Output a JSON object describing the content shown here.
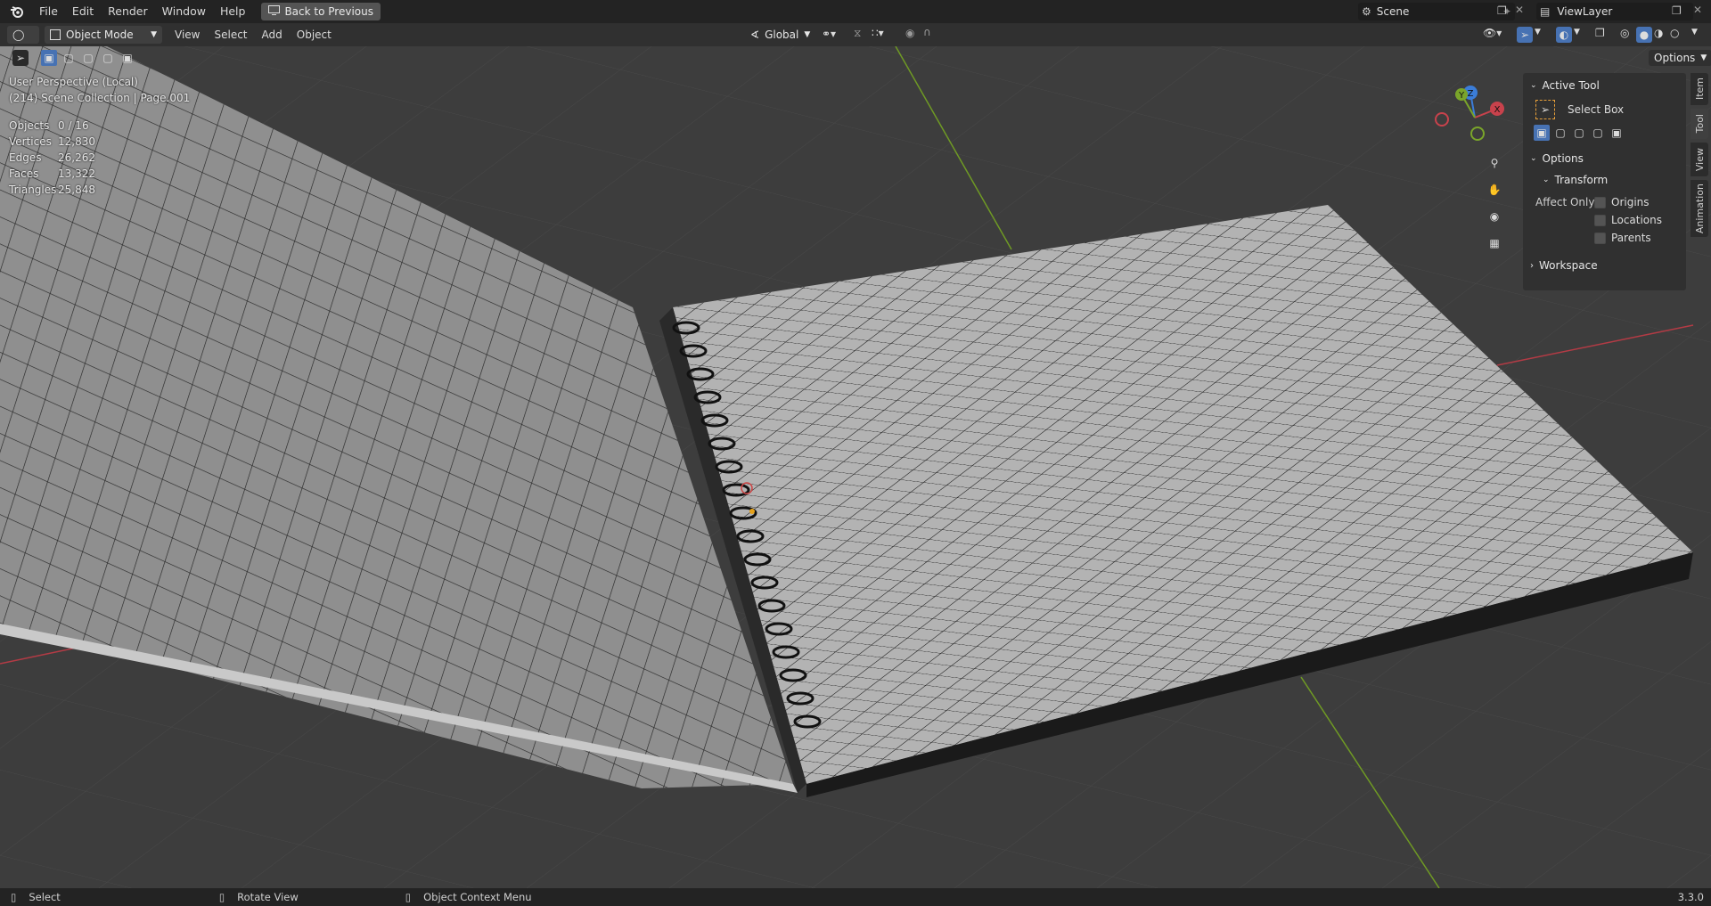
{
  "topbar": {
    "menus": [
      "File",
      "Edit",
      "Render",
      "Window",
      "Help"
    ],
    "back_button": "Back to Previous",
    "scene": "Scene",
    "view_layer": "ViewLayer"
  },
  "header": {
    "mode": "Object Mode",
    "menus": [
      "View",
      "Select",
      "Add",
      "Object"
    ],
    "transform_orientation": "Global",
    "options_label": "Options"
  },
  "viewport": {
    "perspective": "User Perspective (Local)",
    "collection": "(214) Scene Collection | Page.001",
    "stats": [
      {
        "label": "Objects",
        "value": "0 / 16"
      },
      {
        "label": "Vertices",
        "value": "12,830"
      },
      {
        "label": "Edges",
        "value": "26,262"
      },
      {
        "label": "Faces",
        "value": "13,322"
      },
      {
        "label": "Triangles",
        "value": "25,848"
      }
    ],
    "gizmo": {
      "z": "Z",
      "y": "Y",
      "x": "X"
    }
  },
  "npanel": {
    "active_tool_title": "Active Tool",
    "tool_name": "Select Box",
    "options_title": "Options",
    "transform_title": "Transform",
    "affect_only": "Affect Only",
    "checks": [
      "Origins",
      "Locations",
      "Parents"
    ],
    "workspace_title": "Workspace",
    "tabs": [
      "Item",
      "Tool",
      "View",
      "Animation"
    ]
  },
  "statusbar": {
    "select": "Select",
    "rotate": "Rotate View",
    "context": "Object Context Menu",
    "version": "3.3.0"
  },
  "colors": {
    "x_axis": "#c8424c",
    "y_axis": "#7aa52a",
    "z_axis": "#3b7dd8",
    "accent": "#4772b3"
  }
}
